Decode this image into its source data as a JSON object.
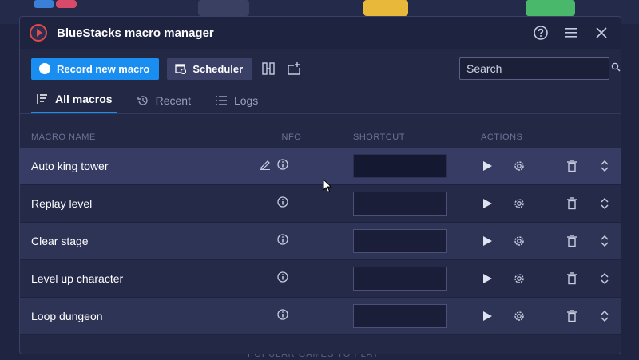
{
  "window": {
    "title": "BlueStacks macro manager"
  },
  "toolbar": {
    "record_label": "Record new macro",
    "scheduler_label": "Scheduler",
    "search_placeholder": "Search"
  },
  "tabs": [
    {
      "label": "All macros",
      "active": true
    },
    {
      "label": "Recent",
      "active": false
    },
    {
      "label": "Logs",
      "active": false
    }
  ],
  "columns": {
    "name": "MACRO NAME",
    "info": "INFO",
    "shortcut": "SHORTCUT",
    "actions": "ACTIONS"
  },
  "macros": [
    {
      "name": "Auto king tower",
      "shortcut": ""
    },
    {
      "name": "Replay level",
      "shortcut": ""
    },
    {
      "name": "Clear stage",
      "shortcut": ""
    },
    {
      "name": "Level up character",
      "shortcut": ""
    },
    {
      "name": "Loop dungeon",
      "shortcut": ""
    }
  ],
  "background": {
    "footer_text": "POPULAR GAMES TO PLAY"
  },
  "colors": {
    "accent": "#1a8ef0",
    "window_bg": "#232845",
    "row_highlight": "#363c63"
  },
  "icons": {
    "app": "bluestacks-logo-icon",
    "help": "help-icon",
    "menu": "hamburger-icon",
    "close": "close-icon",
    "search": "search-icon"
  }
}
